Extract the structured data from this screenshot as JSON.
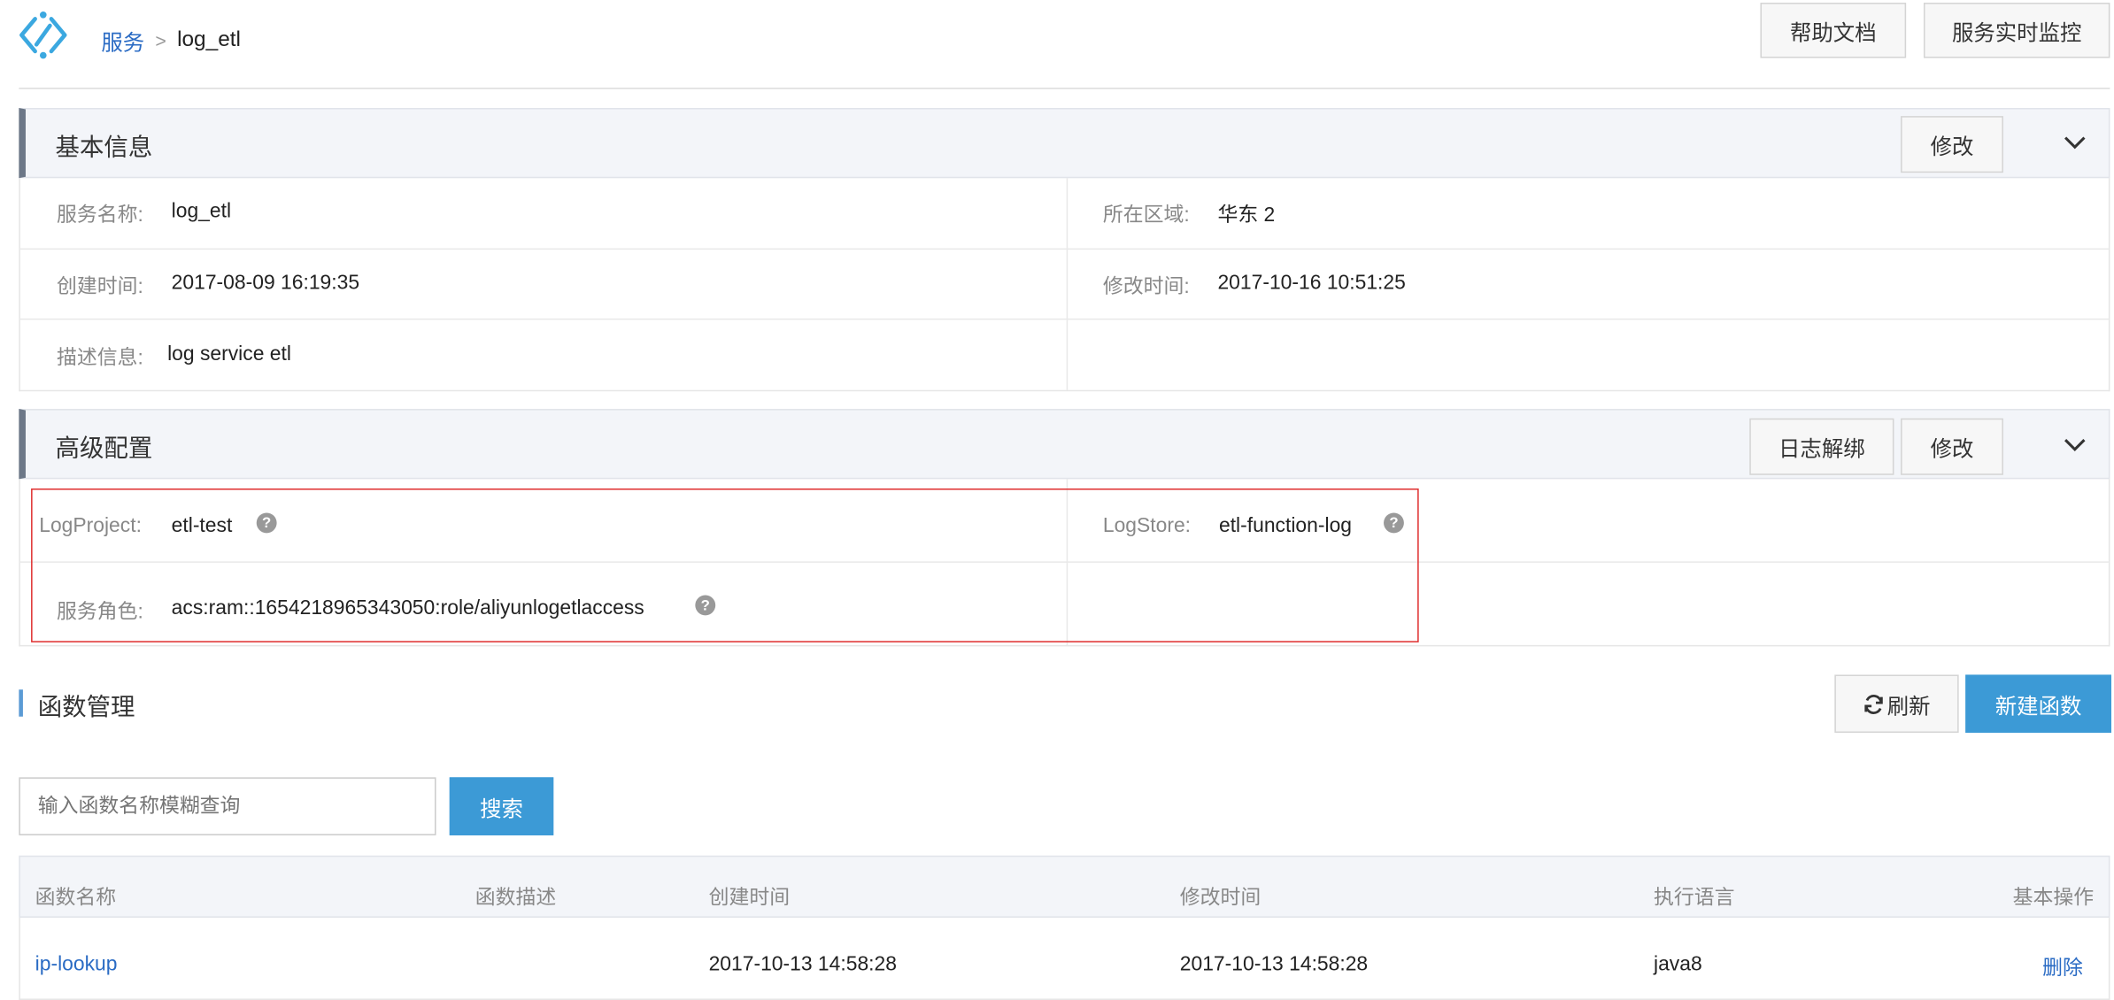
{
  "breadcrumb": {
    "root": "服务",
    "separator": ">",
    "current": "log_etl"
  },
  "header_buttons": {
    "help_docs": "帮助文档",
    "realtime_monitor": "服务实时监控"
  },
  "basic_info": {
    "title": "基本信息",
    "edit_label": "修改",
    "service_name": {
      "label": "服务名称:",
      "value": "log_etl"
    },
    "region": {
      "label": "所在区域:",
      "value": "华东 2"
    },
    "created": {
      "label": "创建时间:",
      "value": "2017-08-09 16:19:35"
    },
    "modified": {
      "label": "修改时间:",
      "value": "2017-10-16 10:51:25"
    },
    "description": {
      "label": "描述信息:",
      "value": "log service etl"
    }
  },
  "advanced": {
    "title": "高级配置",
    "unbind_log_label": "日志解绑",
    "edit_label": "修改",
    "log_project": {
      "label": "LogProject:",
      "value": "etl-test"
    },
    "log_store": {
      "label": "LogStore:",
      "value": "etl-function-log"
    },
    "service_role": {
      "label": "服务角色:",
      "value": "acs:ram::1654218965343050:role/aliyunlogetlaccess"
    }
  },
  "functions": {
    "title": "函数管理",
    "refresh_label": "刷新",
    "new_label": "新建函数",
    "search_placeholder": "输入函数名称模糊查询",
    "search_label": "搜索",
    "columns": [
      "函数名称",
      "函数描述",
      "创建时间",
      "修改时间",
      "执行语言",
      "基本操作"
    ],
    "rows": [
      {
        "name": "ip-lookup",
        "description": "",
        "created": "2017-10-13 14:58:28",
        "modified": "2017-10-13 14:58:28",
        "runtime": "java8",
        "action": "删除"
      }
    ]
  },
  "colors": {
    "accent": "#3c9ad6",
    "link": "#2a6bc4",
    "highlight_border": "#e03131"
  },
  "icons": {
    "logo": "function-compute-logo-icon",
    "help": "help-icon",
    "collapse": "chevron-down-icon",
    "refresh": "refresh-icon"
  }
}
